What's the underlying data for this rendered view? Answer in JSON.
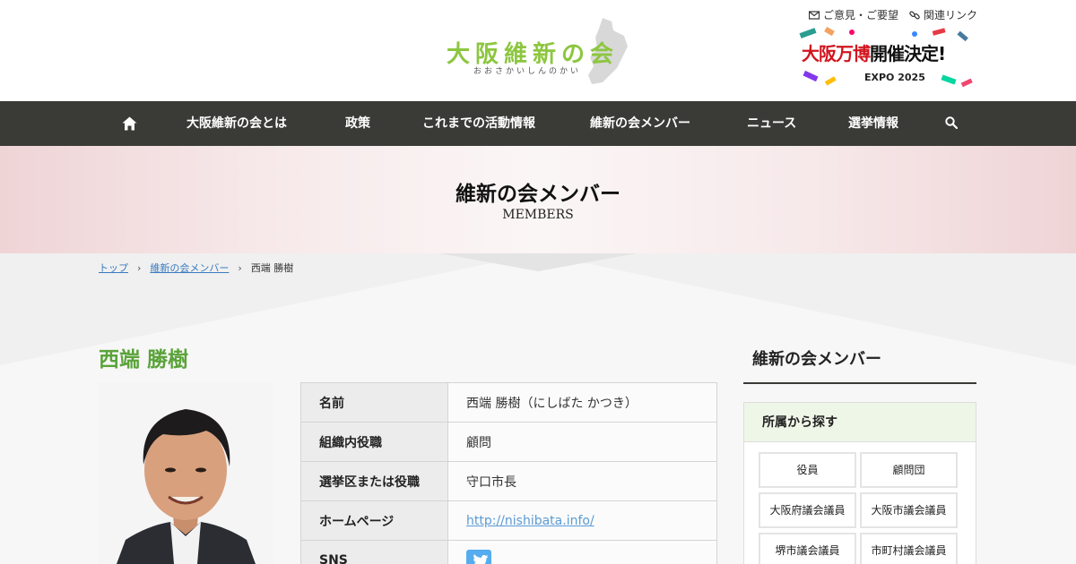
{
  "header": {
    "logo_title": "大阪維新の会",
    "logo_sub": "おおさかいしんのかい",
    "links": [
      {
        "label": "ご意見・ご要望",
        "icon": "envelope-icon"
      },
      {
        "label": "関連リンク",
        "icon": "link-icon"
      }
    ],
    "banner": {
      "title_red": "大阪万博",
      "title_black": "開催決定!",
      "subtitle": "EXPO 2025"
    }
  },
  "nav": {
    "home_icon": "home-icon",
    "items": [
      "大阪維新の会とは",
      "政策",
      "これまでの活動情報",
      "維新の会メンバー",
      "ニュース",
      "選挙情報"
    ],
    "search_icon": "search-icon"
  },
  "hero": {
    "title": "維新の会メンバー",
    "subtitle": "MEMBERS"
  },
  "breadcrumb": {
    "items": [
      "トップ",
      "維新の会メンバー",
      "西端 勝樹"
    ]
  },
  "member": {
    "name": "西端 勝樹",
    "rows": [
      {
        "label": "名前",
        "value": "西端 勝樹（にしばた かつき）"
      },
      {
        "label": "組織内役職",
        "value": "顧問"
      },
      {
        "label": "選挙区または役職",
        "value": "守口市長"
      },
      {
        "label": "ホームページ",
        "value": "http://nishibata.info/"
      },
      {
        "label": "SNS",
        "value": "twitter-icon"
      }
    ]
  },
  "sidebar": {
    "title": "維新の会メンバー",
    "box_title": "所属から探す",
    "buttons": [
      "役員",
      "顧問団",
      "大阪府議会議員",
      "大阪市議会議員",
      "堺市議会議員",
      "市町村議会議員"
    ]
  },
  "colors": {
    "nav_bg": "#3a3b36",
    "accent_green": "#5aa33a",
    "logo_green": "#8cc63f",
    "link_blue": "#5b9bd5",
    "twitter_blue": "#55acee"
  }
}
